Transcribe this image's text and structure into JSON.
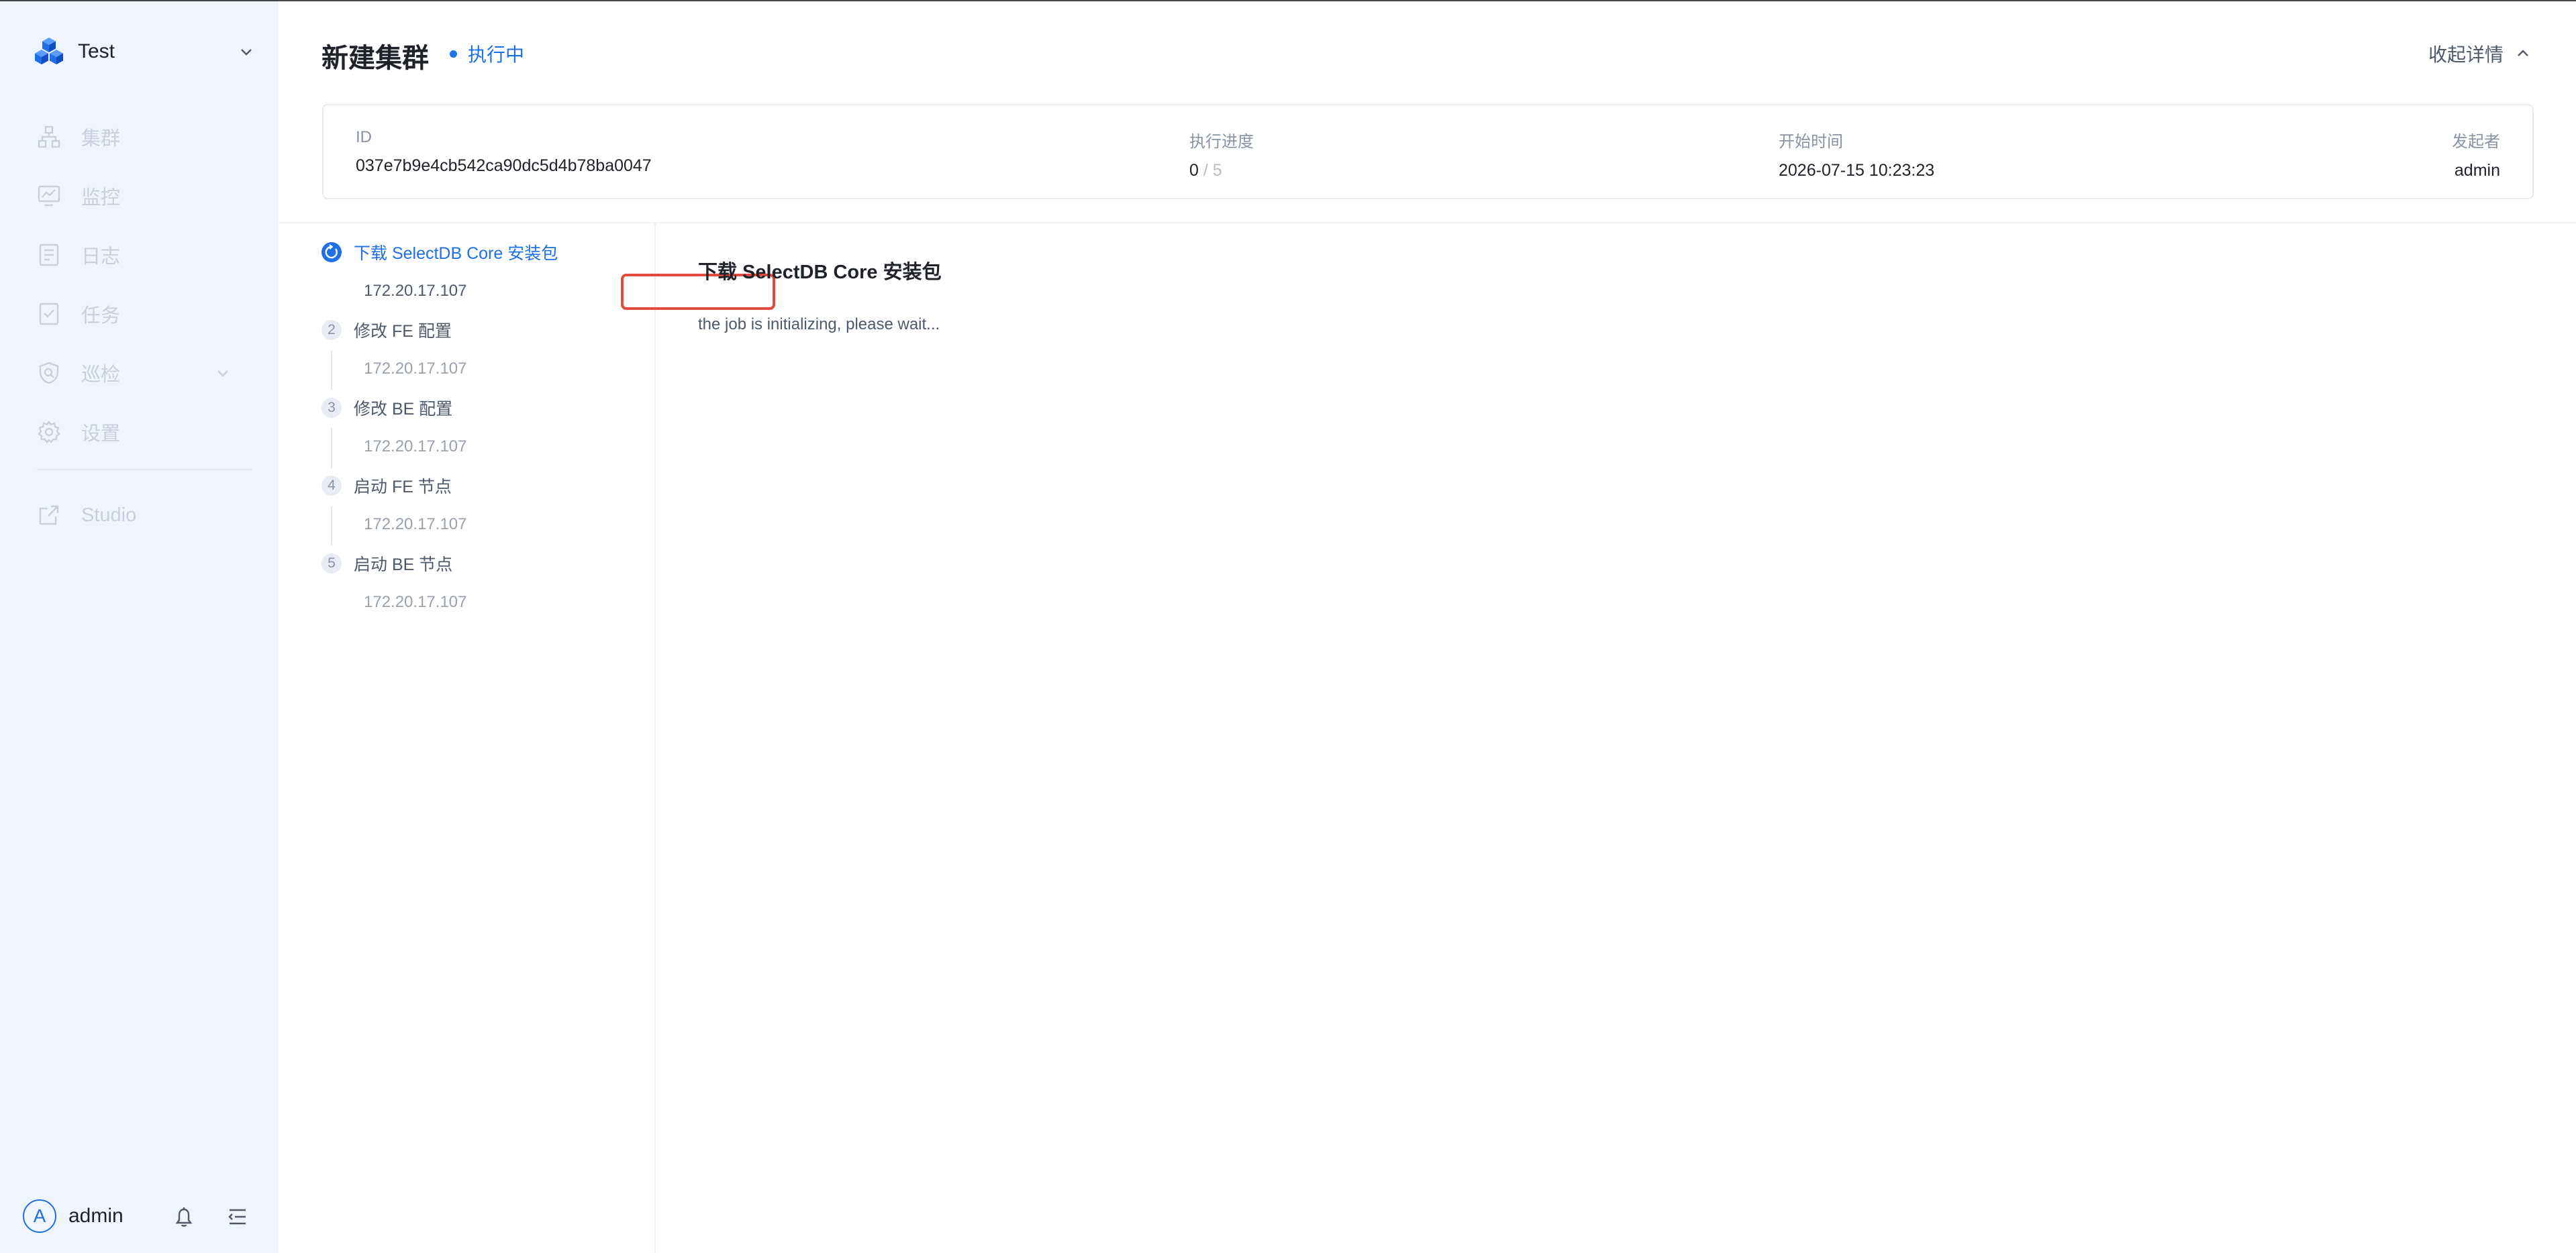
{
  "sidebar": {
    "workspace": "Test",
    "nav": [
      {
        "label": "集群",
        "icon": "cluster-icon"
      },
      {
        "label": "监控",
        "icon": "monitor-icon"
      },
      {
        "label": "日志",
        "icon": "log-icon"
      },
      {
        "label": "任务",
        "icon": "task-icon"
      },
      {
        "label": "巡检",
        "icon": "inspection-icon"
      },
      {
        "label": "设置",
        "icon": "settings-icon"
      }
    ],
    "studio": "Studio",
    "user": {
      "initial": "A",
      "name": "admin"
    }
  },
  "header": {
    "title": "新建集群",
    "status": "执行中",
    "collapse_label": "收起详情"
  },
  "info": {
    "id_label": "ID",
    "id_value": "037e7b9e4cb542ca90dc5d4b78ba0047",
    "progress_label": "执行进度",
    "progress_done": "0",
    "progress_sep": "/",
    "progress_total": "5",
    "start_label": "开始时间",
    "start_value": "2026-07-15 10:23:23",
    "initiator_label": "发起者",
    "initiator_value": "admin"
  },
  "steps": [
    {
      "num": "1",
      "title": "下载 SelectDB Core 安装包",
      "host": "172.20.17.107",
      "active": true
    },
    {
      "num": "2",
      "title": "修改 FE 配置",
      "host": "172.20.17.107"
    },
    {
      "num": "3",
      "title": "修改 BE 配置",
      "host": "172.20.17.107"
    },
    {
      "num": "4",
      "title": "启动 FE 节点",
      "host": "172.20.17.107"
    },
    {
      "num": "5",
      "title": "启动 BE 节点",
      "host": "172.20.17.107"
    }
  ],
  "detail": {
    "title": "下载 SelectDB Core 安装包",
    "message": "the job is initializing, please wait..."
  },
  "colors": {
    "accent": "#1e6fe8",
    "sidebar_bg": "#f0f5fd",
    "highlight": "#e34a3e"
  }
}
